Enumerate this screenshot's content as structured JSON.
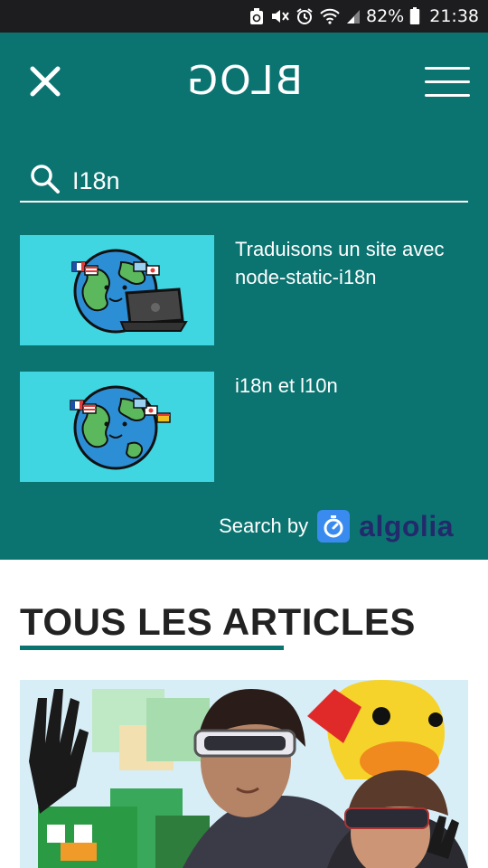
{
  "status_bar": {
    "battery_percent": "82%",
    "time": "21:38",
    "icons": [
      "sync-icon",
      "muted-icon",
      "alarm-icon",
      "wifi-icon",
      "signal-icon",
      "battery-icon"
    ]
  },
  "header": {
    "logo_text": "BLOG",
    "close_icon": "close-icon",
    "menu_icon": "hamburger-menu-icon"
  },
  "search": {
    "value": "I18n",
    "icon": "search-icon"
  },
  "results": [
    {
      "title": "Traduisons un site avec node-static-i18n",
      "thumbnail_icon": "globe-with-laptop-illustration"
    },
    {
      "title": "i18n et l10n",
      "thumbnail_icon": "globe-with-flags-illustration"
    }
  ],
  "powered_by": {
    "label": "Search by",
    "brand": "algolia",
    "icon": "algolia-stopwatch-icon"
  },
  "articles": {
    "section_title": "TOUS LES ARTICLES",
    "featured_image_icon": "vr-headset-illustration"
  },
  "colors": {
    "primary": "#0b7471",
    "thumb_bg": "#3fd6e2",
    "algolia_blue": "#232a6c",
    "status_bar": "#1d1d1f"
  }
}
